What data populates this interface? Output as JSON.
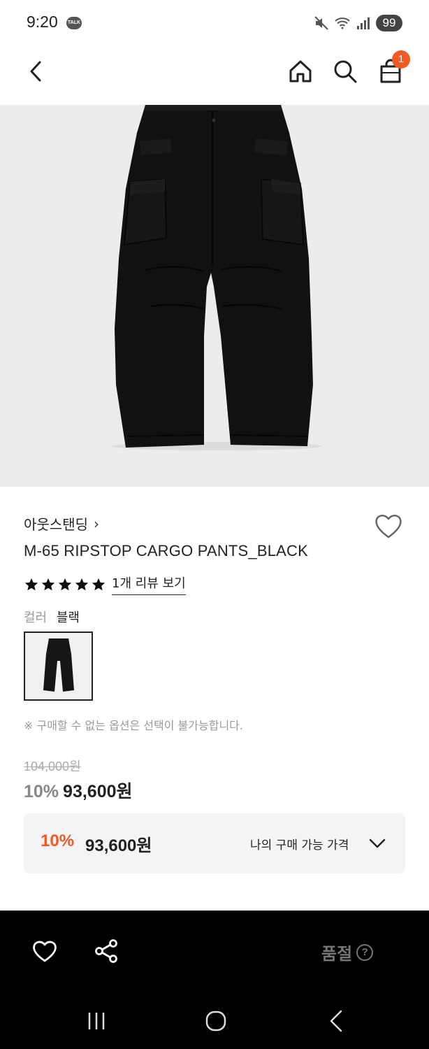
{
  "status_bar": {
    "time": "9:20",
    "talk_badge": "TALK",
    "battery": "99"
  },
  "header": {
    "cart_count": "1"
  },
  "product": {
    "brand": "아웃스탠딩",
    "brand_chevron": "›",
    "title": "M-65 RIPSTOP CARGO PANTS_BLACK",
    "rating_stars": 5,
    "review_link": "1개 리뷰 보기",
    "color_label": "컬러",
    "color_value": "블랙",
    "notice": "※ 구매할 수 없는 옵션은 선택이 불가능합니다.",
    "original_price": "104,000원",
    "discount": "10%",
    "price": "93,600원"
  },
  "best_price": {
    "discount": "10%",
    "price": "93,600원",
    "label": "나의 구매 가능 가격"
  },
  "action_bar": {
    "soldout_label": "품절",
    "help": "?"
  },
  "colors": {
    "accent": "#f15a24",
    "image_bg": "#ececec",
    "action_bar_bg": "#000000"
  }
}
